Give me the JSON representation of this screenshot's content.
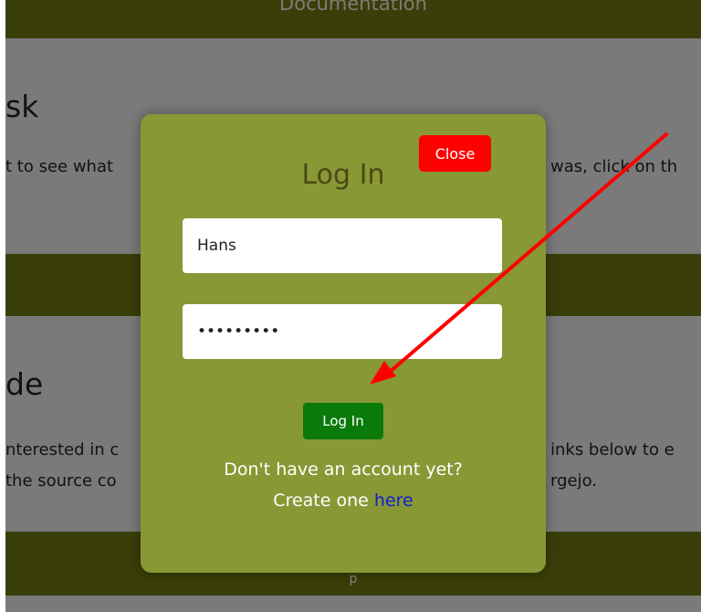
{
  "background": {
    "top_band_label": "Documentation",
    "section1": {
      "heading_fragment": "sk",
      "text_left": "t to see what",
      "text_right": "was, click on th"
    },
    "section2": {
      "heading_fragment": "de",
      "text_left_1": "nterested in c",
      "text_right_1": "inks below to e",
      "text_left_2": "the source co",
      "text_right_2": "rgejo."
    },
    "bottom_band_fragment": "p"
  },
  "modal": {
    "title": "Log In",
    "close_label": "Close",
    "username_value": "Hans",
    "password_value": "•••••••••",
    "login_label": "Log In",
    "signup_prompt": "Don't have an account yet?",
    "create_text": "Create one ",
    "create_link": "here"
  },
  "colors": {
    "modal_bg": "#889835",
    "close_button": "#ff0000",
    "login_button": "#0a7a0a",
    "link": "#1020d0",
    "annotation_arrow": "#ff0000"
  },
  "icons": [
    "annotation-arrow"
  ]
}
